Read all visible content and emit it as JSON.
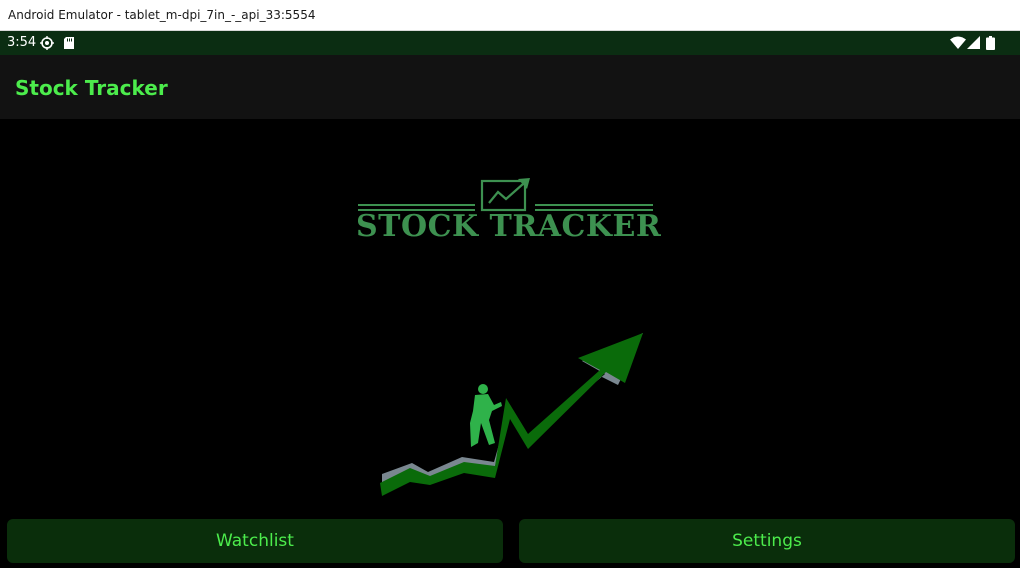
{
  "window": {
    "title": "Android Emulator - tablet_m-dpi_7in_-_api_33:5554"
  },
  "status_bar": {
    "time": "3:54",
    "icons": [
      "gps-icon",
      "sd-card-icon",
      "wifi-icon",
      "signal-icon",
      "battery-icon"
    ]
  },
  "app_bar": {
    "title": "Stock Tracker"
  },
  "logo": {
    "text": "STOCK TRACKER",
    "icon": "trending-chart-icon"
  },
  "buttons": {
    "watchlist": "Watchlist",
    "settings": "Settings"
  },
  "colors": {
    "accent": "#4cec4c",
    "status_bar": "#0b2d12",
    "app_bar": "#121212",
    "button_bg": "#0a2e0b",
    "logo": "#3d9150",
    "arrow": "#0a6b0a"
  }
}
